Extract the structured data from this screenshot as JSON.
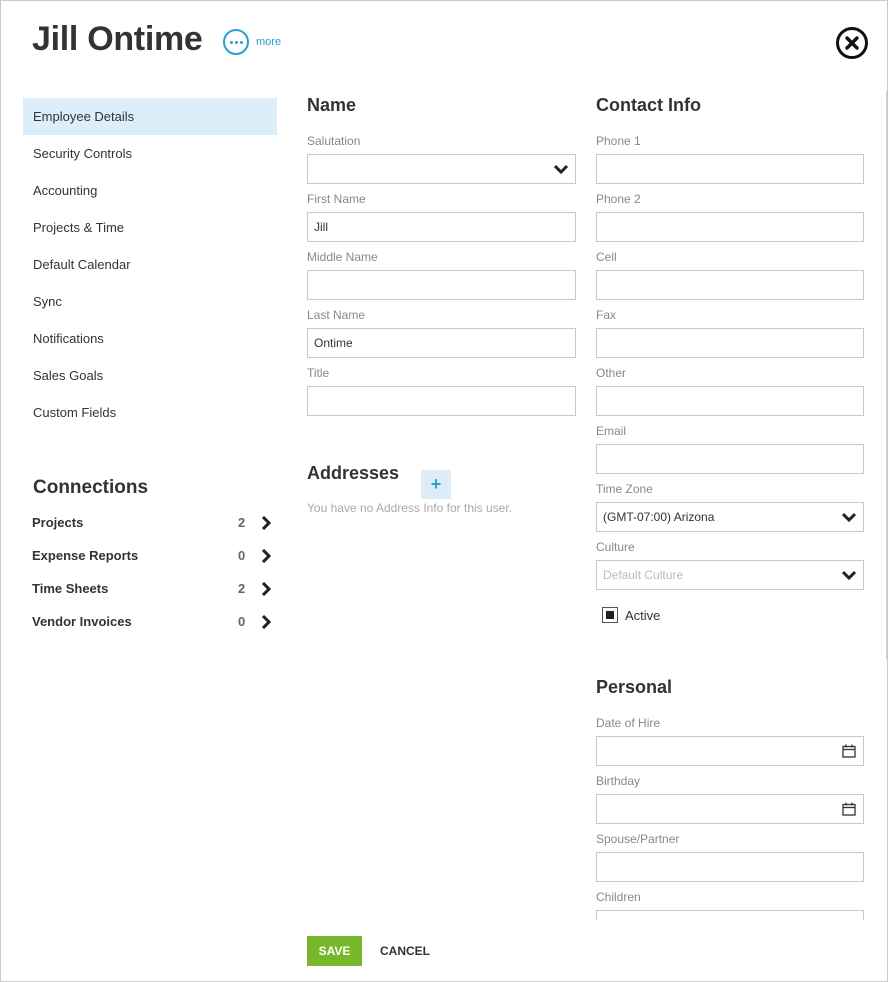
{
  "header": {
    "title": "Jill Ontime",
    "more_label": "more"
  },
  "sidebar": {
    "items": [
      {
        "label": "Employee Details",
        "active": true
      },
      {
        "label": "Security Controls"
      },
      {
        "label": "Accounting"
      },
      {
        "label": "Projects & Time"
      },
      {
        "label": "Default Calendar"
      },
      {
        "label": "Sync"
      },
      {
        "label": "Notifications"
      },
      {
        "label": "Sales Goals"
      },
      {
        "label": "Custom Fields"
      }
    ]
  },
  "connections": {
    "title": "Connections",
    "items": [
      {
        "label": "Projects",
        "count": "2"
      },
      {
        "label": "Expense Reports",
        "count": "0"
      },
      {
        "label": "Time Sheets",
        "count": "2"
      },
      {
        "label": "Vendor Invoices",
        "count": "0"
      }
    ]
  },
  "name_section": {
    "title": "Name",
    "salutation_label": "Salutation",
    "salutation_value": "",
    "first_name_label": "First Name",
    "first_name_value": "Jill",
    "middle_name_label": "Middle Name",
    "middle_name_value": "",
    "last_name_label": "Last Name",
    "last_name_value": "Ontime",
    "title_label": "Title",
    "title_value": ""
  },
  "addresses": {
    "title": "Addresses",
    "add_icon": "plus-icon",
    "empty_text": "You have no Address Info for this user."
  },
  "contact": {
    "title": "Contact Info",
    "phone1_label": "Phone 1",
    "phone1_value": "",
    "phone2_label": "Phone 2",
    "phone2_value": "",
    "cell_label": "Cell",
    "cell_value": "",
    "fax_label": "Fax",
    "fax_value": "",
    "other_label": "Other",
    "other_value": "",
    "email_label": "Email",
    "email_value": "",
    "timezone_label": "Time Zone",
    "timezone_value": "(GMT-07:00) Arizona",
    "culture_label": "Culture",
    "culture_placeholder": "Default Culture",
    "active_label": "Active",
    "active_checked": true
  },
  "personal": {
    "title": "Personal",
    "hire_label": "Date of Hire",
    "hire_value": "",
    "birthday_label": "Birthday",
    "birthday_value": "",
    "spouse_label": "Spouse/Partner",
    "spouse_value": "",
    "children_label": "Children",
    "children_value": ""
  },
  "footer": {
    "save_label": "SAVE",
    "cancel_label": "CANCEL"
  },
  "colors": {
    "accent": "#2a9fd6",
    "save": "#77b82a",
    "active_nav": "#dbeef9"
  }
}
